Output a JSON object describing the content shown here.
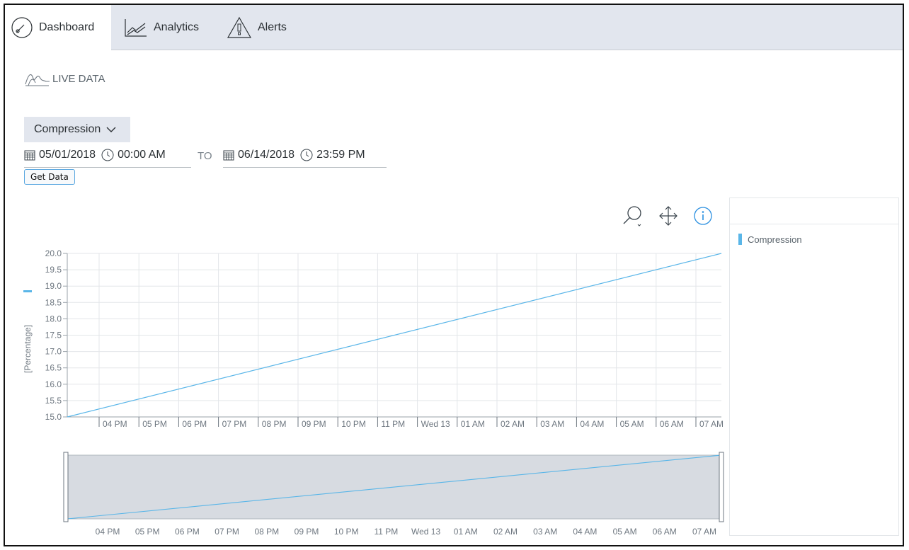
{
  "tabs": [
    {
      "label": "Dashboard",
      "icon": "speedometer-icon",
      "active": true
    },
    {
      "label": "Analytics",
      "icon": "line-chart-icon",
      "active": false
    },
    {
      "label": "Alerts",
      "icon": "warning-icon",
      "active": false
    }
  ],
  "section": {
    "title": "LIVE DATA",
    "icon": "live-data-icon"
  },
  "dropdown": {
    "selected": "Compression"
  },
  "range": {
    "from_date": "05/01/2018",
    "from_time": "00:00 AM",
    "separator": "TO",
    "to_date": "06/14/2018",
    "to_time": "23:59 PM"
  },
  "get_data_label": "Get Data",
  "toolbar": {
    "zoom_icon": "zoom-icon",
    "pan_icon": "pan-icon",
    "info_icon": "info-icon"
  },
  "legend": {
    "label": "Compression",
    "color": "#5ab6e8"
  },
  "chart_data": {
    "type": "line",
    "ylabel": "[Percentage]",
    "ylim": [
      15.0,
      20.0
    ],
    "yticks": [
      "20.0",
      "19.5",
      "19.0",
      "18.5",
      "18.0",
      "17.5",
      "17.0",
      "16.5",
      "16.0",
      "15.5",
      "15.0"
    ],
    "xticks": [
      "04 PM",
      "05 PM",
      "06 PM",
      "07 PM",
      "08 PM",
      "09 PM",
      "10 PM",
      "11 PM",
      "Wed 13",
      "01 AM",
      "02 AM",
      "03 AM",
      "04 AM",
      "05 AM",
      "06 AM",
      "07 AM"
    ],
    "series": [
      {
        "name": "Compression",
        "color": "#5ab6e8",
        "y_start": 15.0,
        "y_end": 20.0
      }
    ]
  }
}
